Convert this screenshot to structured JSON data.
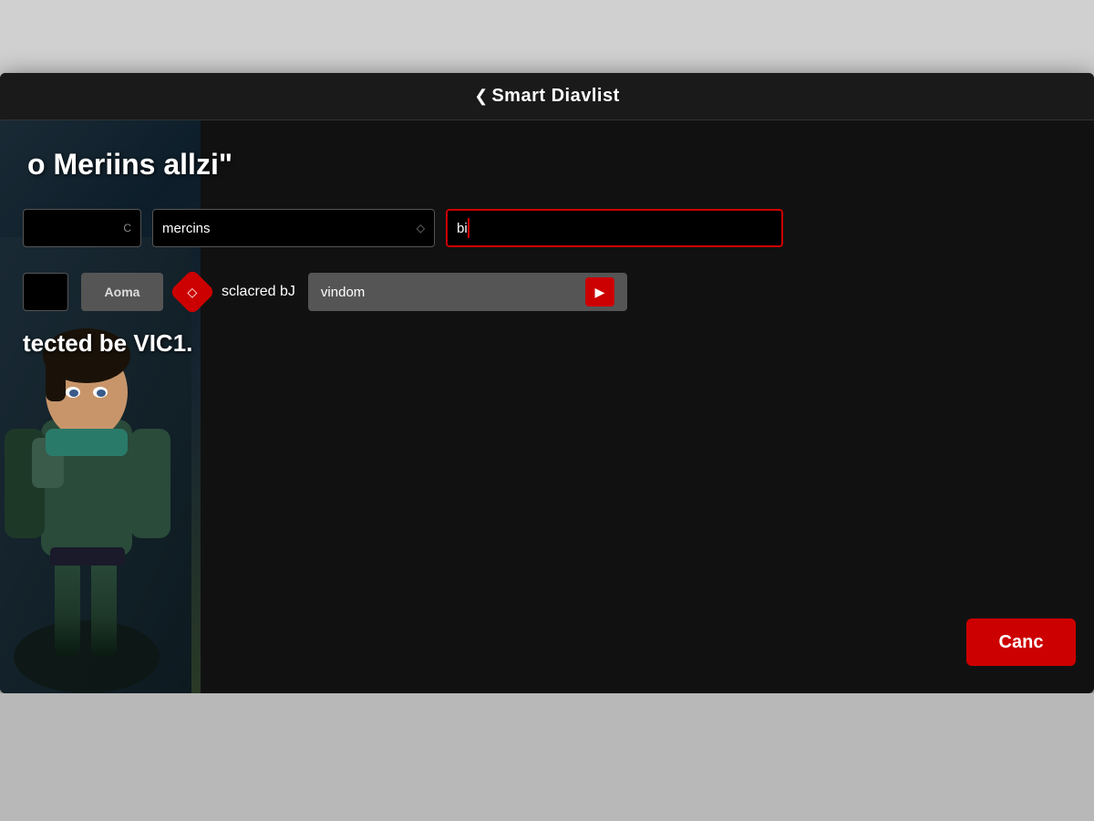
{
  "header": {
    "back_label": "❮",
    "title": "Smart Diavlist"
  },
  "playlist_title": "o Meriins allzi\"",
  "filters": {
    "select1_value": "",
    "select1_arrow": "C",
    "select2_value": "mercins",
    "select2_arrow": "◇",
    "input3_value": "bi",
    "input3_placeholder": ""
  },
  "actions": {
    "btn1_label": "",
    "btn_aoma_label": "Aoma",
    "selected_by_label": "sclacred bJ",
    "dropdown_label": "vindom",
    "dropdown_arrow": "▶"
  },
  "directed_text": "tected be VIC1.",
  "cancel_button": "Canc"
}
